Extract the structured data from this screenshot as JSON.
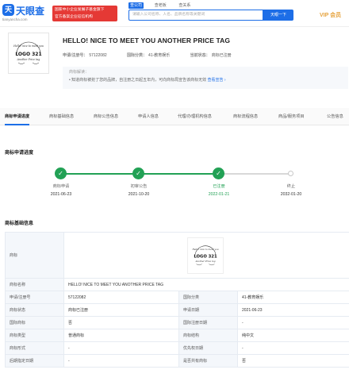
{
  "header": {
    "logo_mark": "天",
    "logo_text": "天眼查",
    "logo_url": "tianyancha.com",
    "gov_badge_line1": "国家中小企业发展子基金旗下",
    "gov_badge_line2": "官方备案企业征信机构",
    "search_tabs": [
      "查公司",
      "查老板",
      "查关系"
    ],
    "search_placeholder": "请输入公司名称、人名、品牌名称等关键词",
    "search_button": "天眼一下",
    "vip": "VIP 会员"
  },
  "trademark": {
    "title": "HELLO! NICE TO MEET YOU ANOTHER PRICE TAG",
    "reg_no_label": "申请/注册号：",
    "reg_no": "57122082",
    "class_label": "国际分类：",
    "class": "41-教育娱乐",
    "status_label": "当前状态：",
    "status": "商标已注册",
    "notice_title": "商标解读：",
    "notice_text": "• 知道商标被抢了您的品牌，自注册之日起五年内，可向商标局宣告该商标无效",
    "notice_link": "查看宣告 ›"
  },
  "tabs": [
    "商标申请进度",
    "商标基础信息",
    "商标公告信息",
    "申请人信息",
    "代理/办理机构信息",
    "商标流程信息",
    "商品/服务项目",
    "公告信息"
  ],
  "progress_section": {
    "title": "商标申请进度",
    "steps": [
      {
        "label": "商标申请",
        "date": "2021-06-23"
      },
      {
        "label": "初审公告",
        "date": "2021-10-20"
      },
      {
        "label": "已注册",
        "date": "2022-01-21"
      },
      {
        "label": "终止",
        "date": "2032-01-20"
      }
    ]
  },
  "info_section": {
    "title": "商标基础信息",
    "logo_label": "商标",
    "name_label": "商标名称",
    "name_value": "HELLO! NICE TO MEET YOU ANOTHER PRICE TAG",
    "rows": [
      {
        "k1": "申请/注册号",
        "v1": "57122082",
        "k2": "国际分类",
        "v2": "41-教育娱乐"
      },
      {
        "k1": "商标状态",
        "v1": "商标已注册",
        "k2": "申请日期",
        "v2": "2021-06-23"
      },
      {
        "k1": "国际商标",
        "v1": "否",
        "k2": "国际注册日期",
        "v2": "-"
      },
      {
        "k1": "商标类型",
        "v1": "普通商标",
        "k2": "商标结构",
        "v2": "纯中文"
      },
      {
        "k1": "商标形式",
        "v1": "-",
        "k2": "优先权日期",
        "v2": "-"
      },
      {
        "k1": "后期指定日期",
        "v1": "-",
        "k2": "是否共有商标",
        "v2": "否"
      }
    ]
  },
  "logo_text": {
    "top": "Hello! nice to meet you",
    "main": "LOGO 321",
    "bottom": "Another Price tag"
  },
  "colors": {
    "brand_blue": "#1d6ee7",
    "done_green": "#22a155",
    "vip_gold": "#e6a23c"
  }
}
